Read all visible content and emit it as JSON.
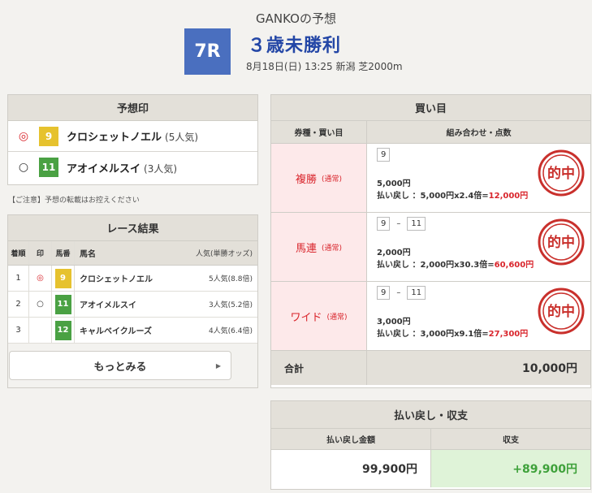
{
  "header": {
    "author": "GANKOの予想",
    "race_number": "7R",
    "race_name": "３歳未勝利",
    "race_info": "8月18日(日) 13:25 新潟 芝2000m"
  },
  "picks": {
    "title": "予想印",
    "rows": [
      {
        "mark": "◎",
        "number": "9",
        "horse": "クロシェットノエル",
        "popularity": "(5人気)"
      },
      {
        "mark": "○",
        "number": "11",
        "horse": "アオイメルスイ",
        "popularity": "(3人気)"
      }
    ],
    "notice": "【ご注意】予想の転載はお控えください"
  },
  "results": {
    "title": "レース結果",
    "headers": [
      "着順",
      "印",
      "馬番",
      "馬名",
      "人気(単勝オッズ)"
    ],
    "rows": [
      {
        "rank": "1",
        "mark": "◎",
        "number": "9",
        "horse": "クロシェットノエル",
        "pop": "5人気(8.8倍)"
      },
      {
        "rank": "2",
        "mark": "○",
        "number": "11",
        "horse": "アオイメルスイ",
        "pop": "3人気(5.2倍)"
      },
      {
        "rank": "3",
        "mark": "",
        "number": "12",
        "horse": "キャルベイクルーズ",
        "pop": "4人気(6.4倍)"
      }
    ],
    "more_label": "もっとみる",
    "more_arrow": "▶"
  },
  "buy": {
    "title": "買い目",
    "col1": "券種・買い目",
    "col2": "組み合わせ・点数",
    "rows": [
      {
        "type": "複勝",
        "note": "(通常)",
        "combo": [
          "9"
        ],
        "amount": "5,000円",
        "payout_label": "払い戻し ：5,000円x2.4倍=",
        "payout_value": "12,000円",
        "stamp": "的中"
      },
      {
        "type": "馬連",
        "note": "(通常)",
        "combo": [
          "9",
          "11"
        ],
        "dash": "–",
        "amount": "2,000円",
        "payout_label": "払い戻し ：2,000円x30.3倍=",
        "payout_value": "60,600円",
        "stamp": "的中"
      },
      {
        "type": "ワイド",
        "note": "(通常)",
        "combo": [
          "9",
          "11"
        ],
        "dash": "–",
        "amount": "3,000円",
        "payout_label": "払い戻し ：3,000円x9.1倍=",
        "payout_value": "27,300円",
        "stamp": "的中"
      }
    ],
    "total_label": "合計",
    "total_value": "10,000円"
  },
  "summary": {
    "title": "払い戻し・収支",
    "payout_label": "払い戻し金額",
    "profit_label": "収支",
    "payout_value": "99,900円",
    "profit_value": "+89,900円"
  },
  "colors": {
    "accent_blue": "#4a6fbf",
    "race_name": "#2346a6",
    "hit_red": "#d9252c",
    "profit_green": "#3ea13a"
  }
}
